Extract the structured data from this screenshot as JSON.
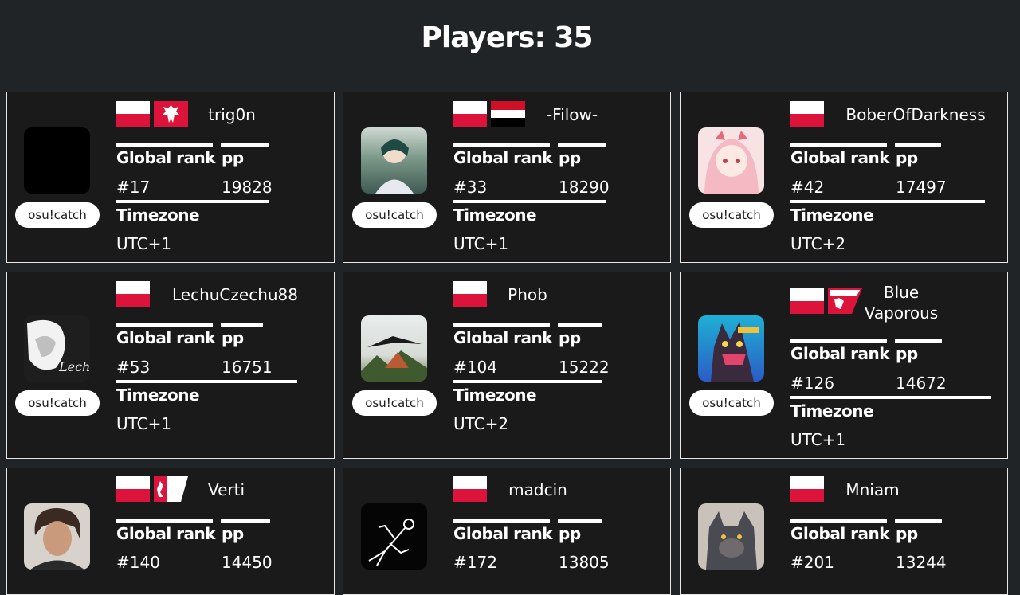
{
  "header": {
    "title": "Players: 35"
  },
  "labels": {
    "global_rank": "Global rank",
    "pp": "pp",
    "timezone": "Timezone"
  },
  "colors": {
    "background": "#212427",
    "card": "#1a1a1a",
    "flag_red": "#dc143c",
    "flag_white": "#ffffff"
  },
  "players": [
    {
      "username": "trig0n",
      "rank": "#17",
      "pp": "19828",
      "timezone": "UTC+1",
      "mode": "osu!catch",
      "flags": [
        "poland-flag",
        "polish-eagle-flag"
      ]
    },
    {
      "username": "-Filow-",
      "rank": "#33",
      "pp": "18290",
      "timezone": "UTC+1",
      "mode": "osu!catch",
      "flags": [
        "poland-flag",
        "yemen-flag"
      ]
    },
    {
      "username": "BoberOfDarkness",
      "rank": "#42",
      "pp": "17497",
      "timezone": "UTC+2",
      "mode": "osu!catch",
      "flags": [
        "poland-flag"
      ]
    },
    {
      "username": "LechuCzechu88",
      "rank": "#53",
      "pp": "16751",
      "timezone": "UTC+1",
      "mode": "osu!catch",
      "flags": [
        "poland-flag"
      ]
    },
    {
      "username": "Phob",
      "rank": "#104",
      "pp": "15222",
      "timezone": "UTC+2",
      "mode": "osu!catch",
      "flags": [
        "poland-flag"
      ]
    },
    {
      "username": "Blue Vaporous",
      "rank": "#126",
      "pp": "14672",
      "timezone": "UTC+1",
      "mode": "osu!catch",
      "flags": [
        "poland-flag",
        "regional-eagle-flag"
      ]
    },
    {
      "username": "Verti",
      "rank": "#140",
      "pp": "14450",
      "timezone": "",
      "mode": "",
      "flags": [
        "poland-flag",
        "regional-griffin-flag"
      ]
    },
    {
      "username": "madcin",
      "rank": "#172",
      "pp": "13805",
      "timezone": "",
      "mode": "",
      "flags": [
        "poland-flag"
      ]
    },
    {
      "username": "Mniam",
      "rank": "#201",
      "pp": "13244",
      "timezone": "",
      "mode": "",
      "flags": [
        "poland-flag"
      ]
    }
  ]
}
